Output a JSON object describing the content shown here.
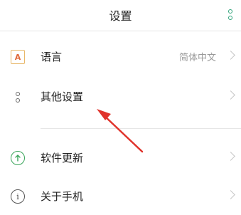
{
  "header": {
    "title": "设置",
    "menu_icon": "more-vertical-icon"
  },
  "accent_color": "#2fa37a",
  "items": [
    {
      "label": "语言",
      "value": "简体中文",
      "icon": "language-icon"
    },
    {
      "label": "其他设置",
      "value": "",
      "icon": "other-settings-icon"
    },
    {
      "label": "软件更新",
      "value": "",
      "icon": "update-icon"
    },
    {
      "label": "关于手机",
      "value": "",
      "icon": "info-icon",
      "icon_glyph": "i"
    }
  ],
  "language_icon_glyph": "A",
  "annotation": {
    "color": "#e0332b"
  }
}
